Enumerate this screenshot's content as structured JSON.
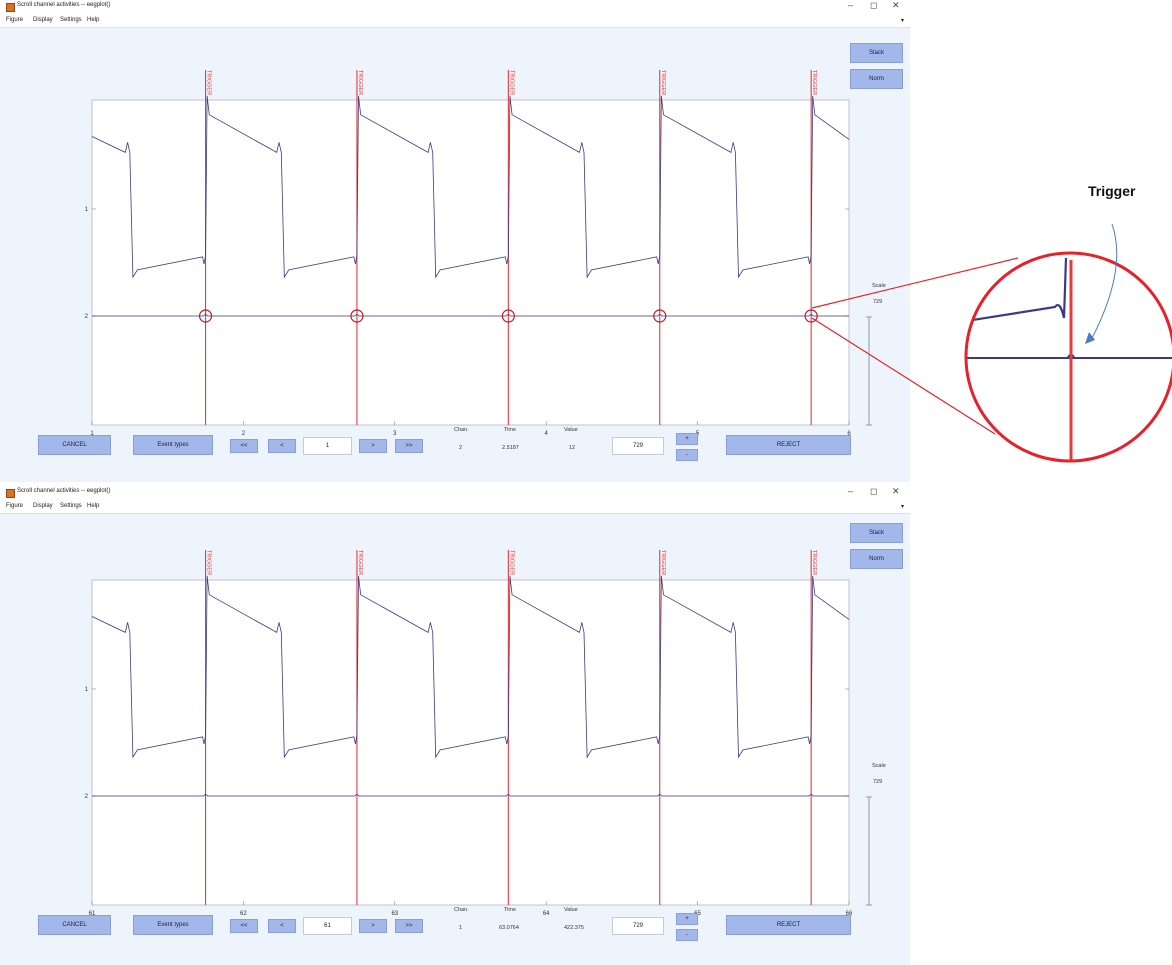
{
  "annotation": {
    "label": "Trigger"
  },
  "windows": [
    {
      "title": "Scroll channel activities -- eegplot()",
      "menu": [
        "Figure",
        "Display",
        "Settings",
        "Help"
      ],
      "buttons": {
        "stack": "Stack",
        "norm": "Norm",
        "cancel": "CANCEL",
        "event_types": "Event types",
        "fast_back": "<<",
        "back": "<",
        "fwd": ">",
        "fast_fwd": ">>",
        "plus": "+",
        "minus": "-",
        "reject": "REJECT"
      },
      "position_value": "1",
      "status": {
        "chan_label": "Chan.",
        "time_label": "Time",
        "value_label": "Value",
        "chan": "2",
        "time": "2.5187",
        "value": "12"
      },
      "scale_field": "729",
      "scale_label": "Scale",
      "scale_value": "729",
      "chart_data": {
        "type": "line",
        "x_ticks": [
          "1",
          "2",
          "3",
          "4",
          "5",
          "6"
        ],
        "xlim": [
          1,
          6
        ],
        "y_ticks": [
          "1",
          "2"
        ],
        "event_label": "TRIGGER",
        "event_times": [
          1.75,
          2.75,
          3.75,
          4.75,
          5.75
        ],
        "series": [
          {
            "channel": "1",
            "shape": "sawtooth with spikes at each trigger"
          },
          {
            "channel": "2",
            "shape": "flat baseline with small bumps at each trigger"
          }
        ],
        "highlight_markers": true,
        "colors": {
          "signal": "#3a3a86",
          "event": "#e8393d"
        }
      }
    },
    {
      "title": "Scroll channel activities -- eegplot()",
      "menu": [
        "Figure",
        "Display",
        "Settings",
        "Help"
      ],
      "buttons": {
        "stack": "Stack",
        "norm": "Norm",
        "cancel": "CANCEL",
        "event_types": "Event types",
        "fast_back": "<<",
        "back": "<",
        "fwd": ">",
        "fast_fwd": ">>",
        "plus": "+",
        "minus": "-",
        "reject": "REJECT"
      },
      "position_value": "61",
      "status": {
        "chan_label": "Chan.",
        "time_label": "Time",
        "value_label": "Value",
        "chan": "1",
        "time": "63.0764",
        "value": "422.375"
      },
      "scale_field": "729",
      "scale_label": "Scale",
      "scale_value": "729",
      "chart_data": {
        "type": "line",
        "x_ticks": [
          "61",
          "62",
          "63",
          "64",
          "65",
          "66"
        ],
        "xlim": [
          61,
          66
        ],
        "y_ticks": [
          "1",
          "2"
        ],
        "event_label": "TRIGGER",
        "event_times": [
          61.75,
          62.75,
          63.75,
          64.75,
          65.75
        ],
        "series": [
          {
            "channel": "1",
            "shape": "sawtooth with spikes at each trigger"
          },
          {
            "channel": "2",
            "shape": "flat baseline with small bumps at each trigger"
          }
        ],
        "highlight_markers": false,
        "colors": {
          "signal": "#3a3a86",
          "event": "#e8393d"
        }
      }
    }
  ]
}
